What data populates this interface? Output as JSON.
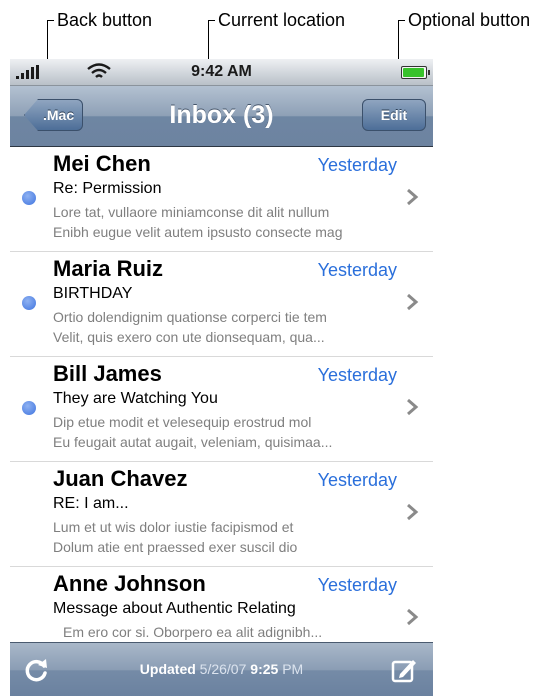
{
  "callouts": {
    "back": "Back button",
    "location": "Current location",
    "optional": "Optional button"
  },
  "status_bar": {
    "carrier": ".all",
    "time": "9:42 AM"
  },
  "nav": {
    "back_label": ".Mac",
    "title": "Inbox (3)",
    "edit_label": "Edit"
  },
  "messages": [
    {
      "sender": "Mei Chen",
      "date": "Yesterday",
      "subject": "Re: Permission",
      "preview1": "Lore tat, vullaore miniamconse dit alit nullum",
      "preview2": "Enibh eugue velit autem ipsusto consecte mag",
      "unread": true
    },
    {
      "sender": "Maria Ruiz",
      "date": "Yesterday",
      "subject": "BIRTHDAY",
      "preview1": "Ortio dolendignim quationse corperci tie tem",
      "preview2": "Velit, quis exero con ute dionsequam, qua...",
      "unread": true
    },
    {
      "sender": "Bill James",
      "date": "Yesterday",
      "subject": "They are Watching You",
      "preview1": "Dip etue modit et velesequip erostrud mol",
      "preview2": "Eu feugait autat augait, veleniam, quisimaa...",
      "unread": true
    },
    {
      "sender": "Juan Chavez",
      "date": "Yesterday",
      "subject": "RE: I am...",
      "preview1": "Lum et ut wis dolor iustie facipismod et",
      "preview2": "Dolum atie ent praessed exer suscil dio",
      "unread": false
    },
    {
      "sender": "Anne Johnson",
      "date": "Yesterday",
      "subject": "Message about Authentic Relating",
      "preview1": "Em ero cor si. Oborpero ea alit adignibh...",
      "preview2": "",
      "unread": false
    }
  ],
  "toolbar": {
    "updated_label": "Updated",
    "updated_date": "5/26/07",
    "updated_time": "9:25",
    "updated_ampm": "PM"
  },
  "icons": {
    "refresh": "refresh-icon",
    "compose": "compose-icon",
    "chevron": "chevron-right-icon"
  },
  "colors": {
    "accent_blue": "#2a6fdb",
    "unread_dot": "#3f74df",
    "navbar": "#6e86a3"
  }
}
